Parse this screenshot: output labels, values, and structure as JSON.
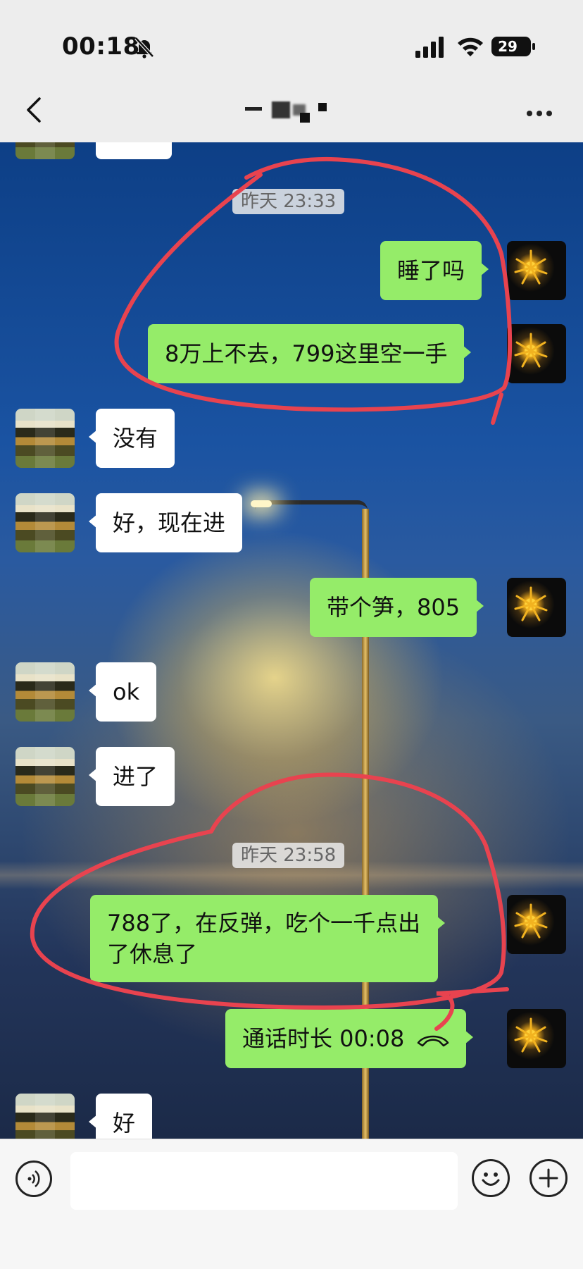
{
  "status_bar": {
    "time": "00:18",
    "battery": "29"
  },
  "nav": {
    "title": "一",
    "back_icon": "chevron-left-icon",
    "more_icon": "more-icon"
  },
  "messages": [
    {
      "type": "timestamp",
      "text": "昨天 23:33"
    },
    {
      "type": "out",
      "text": "睡了吗"
    },
    {
      "type": "out",
      "text": "8万上不去，799这里空一手"
    },
    {
      "type": "in",
      "text": "没有"
    },
    {
      "type": "in",
      "text": "好，现在进"
    },
    {
      "type": "out",
      "text": "带个笋，805"
    },
    {
      "type": "in",
      "text": "ok"
    },
    {
      "type": "in",
      "text": "进了"
    },
    {
      "type": "timestamp",
      "text": "昨天 23:58"
    },
    {
      "type": "out",
      "text": "788了，在反弹，吃个一千点出了休息了"
    },
    {
      "type": "out_call",
      "text": "通话时长 00:08"
    },
    {
      "type": "in",
      "text": "好"
    }
  ],
  "input_bar": {
    "voice_icon": "voice-icon",
    "emoji_icon": "emoji-icon",
    "plus_icon": "plus-icon",
    "value": ""
  },
  "colors": {
    "outgoing_bubble": "#95ec69",
    "incoming_bubble": "#ffffff",
    "annotation": "#e8434f"
  }
}
